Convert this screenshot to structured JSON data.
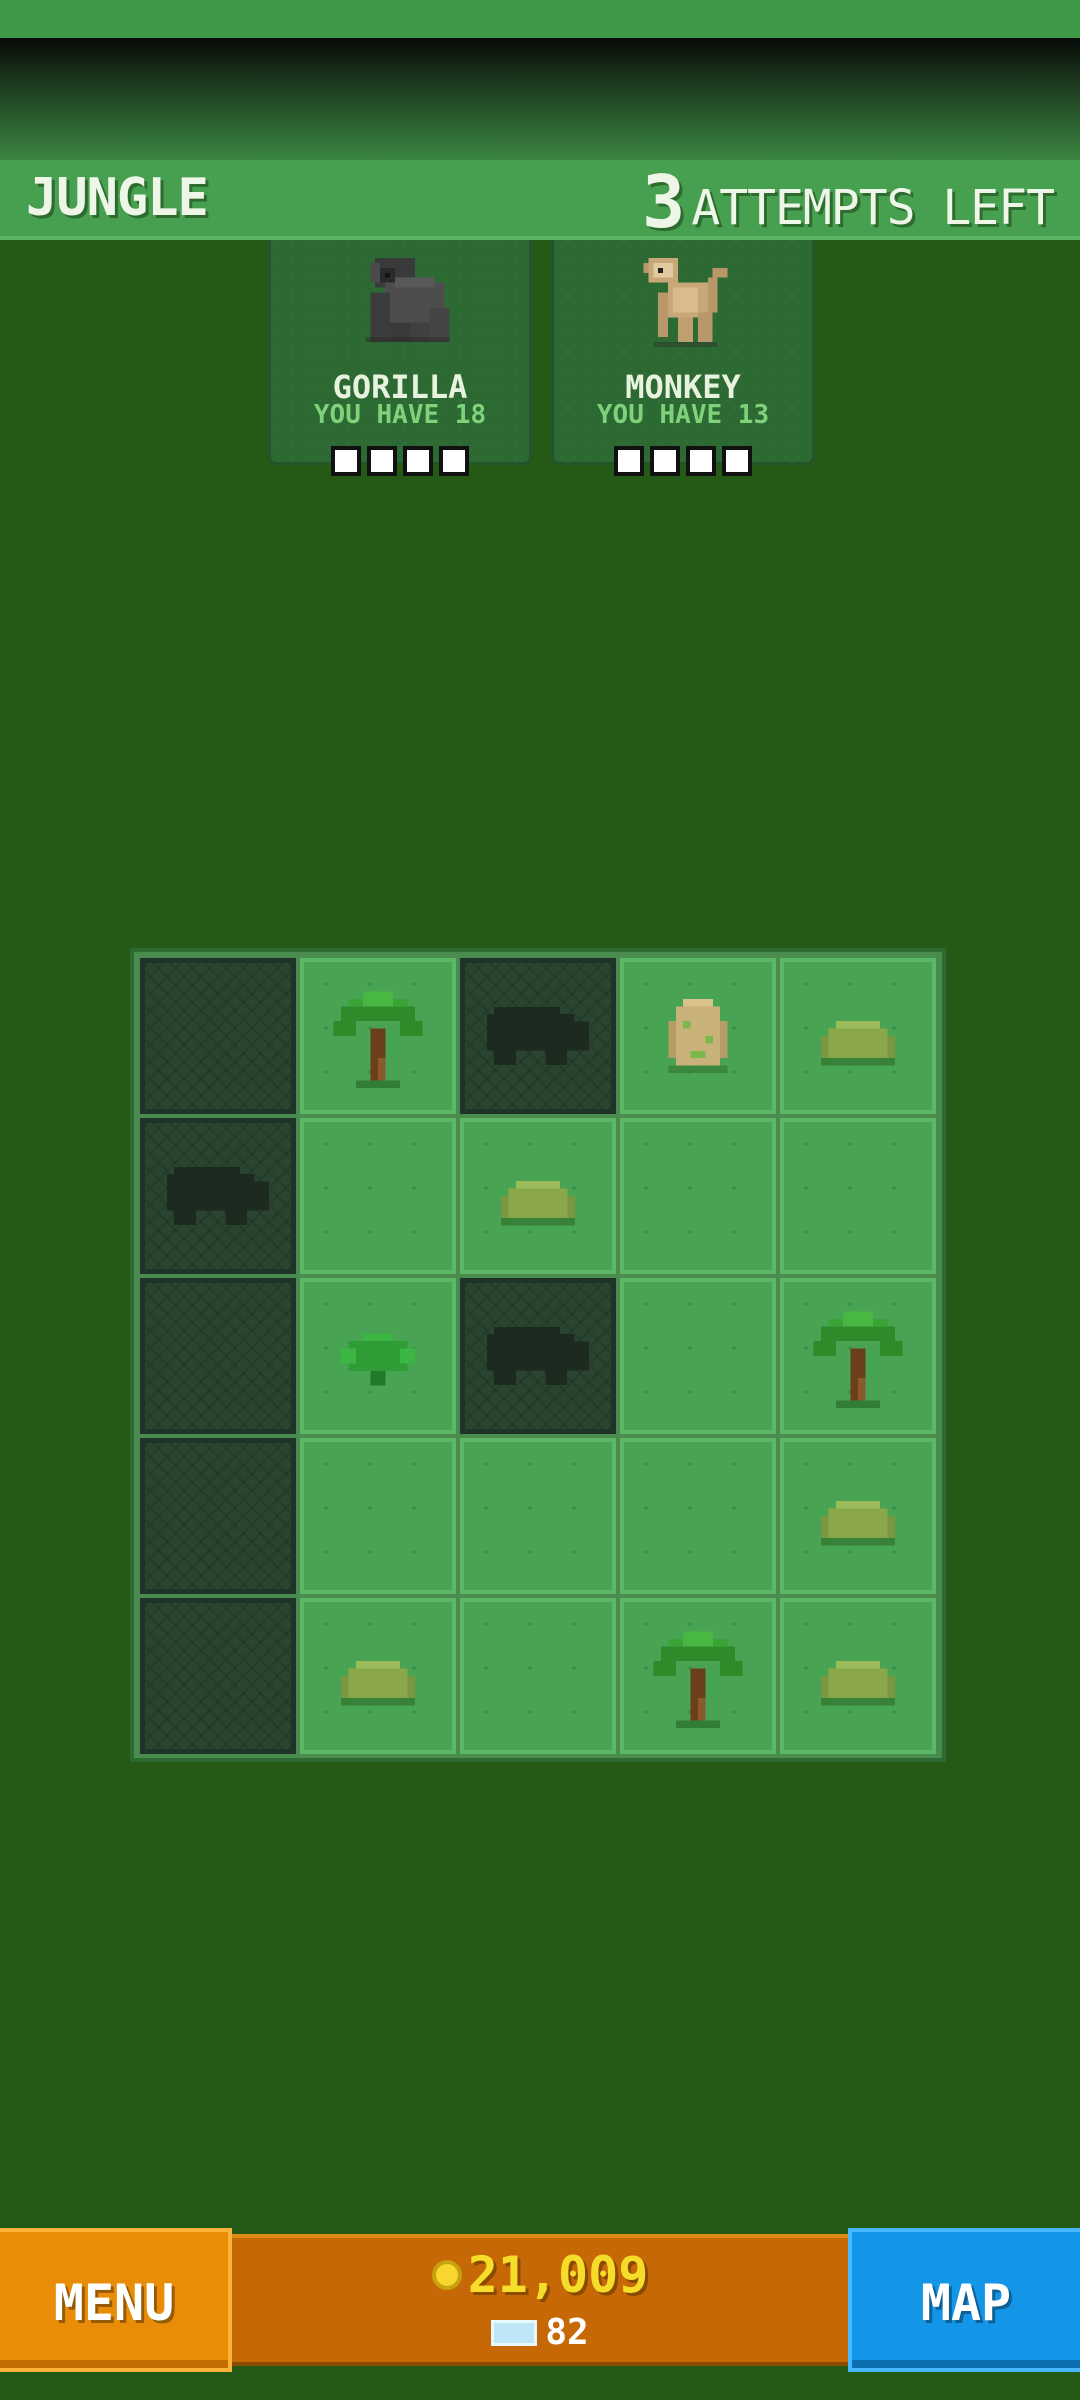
{
  "header": {
    "level_name": "JUNGLE",
    "attempts_count": "3",
    "attempts_label": "ATTEMPTS LEFT"
  },
  "targets": [
    {
      "name": "GORILLA",
      "have": "YOU HAVE 18",
      "found": 0,
      "total": 4,
      "icon": "gorilla-icon"
    },
    {
      "name": "MONKEY",
      "have": "YOU HAVE 13",
      "found": 0,
      "total": 4,
      "icon": "monkey-icon"
    }
  ],
  "board": {
    "rows": 5,
    "cols": 5,
    "cells": [
      [
        "dug",
        "palm",
        "dug-silhouette",
        "rock-fossil",
        "bush"
      ],
      [
        "dug-silhouette",
        "grass",
        "bush",
        "grass",
        "grass"
      ],
      [
        "dug",
        "fern",
        "dug-silhouette",
        "grass",
        "palm"
      ],
      [
        "dug",
        "grass",
        "grass",
        "grass",
        "bush"
      ],
      [
        "dug",
        "bush",
        "grass",
        "palm",
        "bush"
      ]
    ]
  },
  "bottom": {
    "menu_label": "MENU",
    "coins": "21,009",
    "tickets": "82",
    "map_label": "MAP"
  },
  "colors": {
    "background": "#245a16",
    "header": "#46a050",
    "menu_button": "#e98c08",
    "map_button": "#1496e8",
    "coins_text": "#f6dd2a"
  }
}
